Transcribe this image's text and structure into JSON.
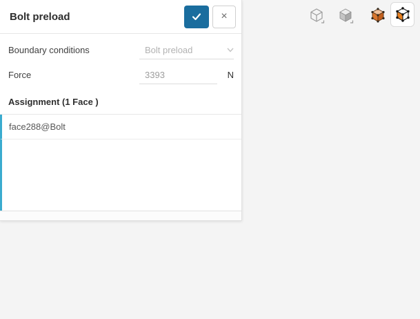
{
  "dialog": {
    "title": "Bolt preload",
    "close_symbol": "×",
    "boundary_conditions": {
      "label": "Boundary conditions",
      "value": "Bolt preload"
    },
    "force": {
      "label": "Force",
      "value": "3393",
      "unit": "N"
    },
    "assignment": {
      "header": "Assignment (1 Face )",
      "items": [
        {
          "label": "face288@Bolt"
        }
      ]
    }
  },
  "toolbar": {
    "buttons": [
      {
        "icon": "wireframe-cube-icon",
        "selected": false
      },
      {
        "icon": "shaded-cube-icon",
        "selected": false
      },
      {
        "icon": "shaded-solid-cube-icon",
        "selected": false
      },
      {
        "icon": "topology-cube-icon",
        "selected": true
      }
    ]
  },
  "colors": {
    "confirm_blue": "#1a6d9e",
    "selection_cyan": "#3aabcf",
    "highlight_orange": "#e07c04",
    "part_light_blue": "#bdd9ec",
    "clamp_navy": "#2a4c87"
  }
}
